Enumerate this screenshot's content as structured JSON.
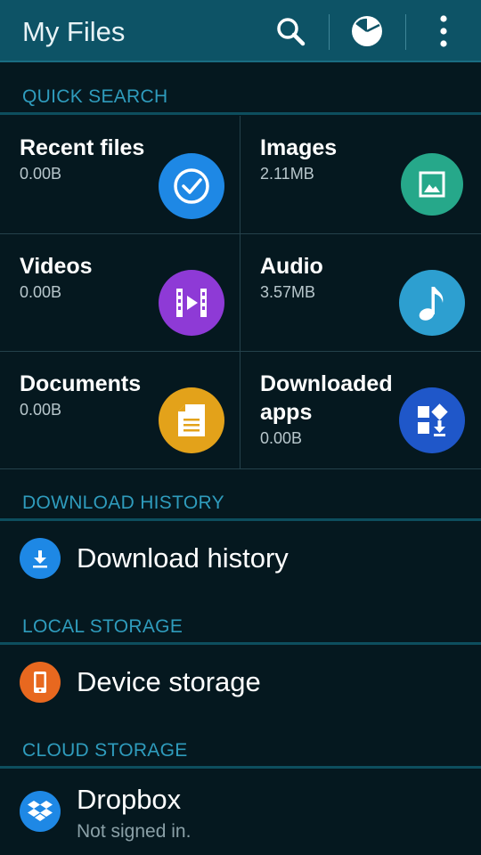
{
  "appbar": {
    "title": "My Files",
    "actions": [
      "search-icon",
      "storage-usage-icon",
      "more-options-icon"
    ]
  },
  "colors": {
    "appbar": "#0d5366",
    "background": "#05181f",
    "section_header": "#2f9cbd",
    "recent": "#1e88e5",
    "images": "#26a88a",
    "videos": "#8e3ad6",
    "audio": "#2d9fd0",
    "documents": "#e3a21a",
    "downloaded_apps": "#1f57c9",
    "download_history": "#1e88e5",
    "device_storage": "#e8681f",
    "dropbox": "#1e88e5"
  },
  "quick_search": {
    "header": "QUICK SEARCH",
    "items": [
      {
        "name": "Recent files",
        "size": "0.00B",
        "icon": "recent-check-icon"
      },
      {
        "name": "Images",
        "size": "2.11MB",
        "icon": "image-icon"
      },
      {
        "name": "Videos",
        "size": "0.00B",
        "icon": "video-icon"
      },
      {
        "name": "Audio",
        "size": "3.57MB",
        "icon": "music-note-icon"
      },
      {
        "name": "Documents",
        "size": "0.00B",
        "icon": "document-icon"
      },
      {
        "name": "Downloaded\napps",
        "size": "0.00B",
        "icon": "downloaded-apps-icon"
      }
    ]
  },
  "download_history": {
    "header": "DOWNLOAD HISTORY",
    "item": {
      "label": "Download history",
      "icon": "download-icon"
    }
  },
  "local_storage": {
    "header": "LOCAL STORAGE",
    "item": {
      "label": "Device storage",
      "icon": "phone-icon"
    }
  },
  "cloud_storage": {
    "header": "CLOUD STORAGE",
    "item": {
      "label": "Dropbox",
      "sublabel": "Not signed in.",
      "icon": "dropbox-icon"
    }
  }
}
